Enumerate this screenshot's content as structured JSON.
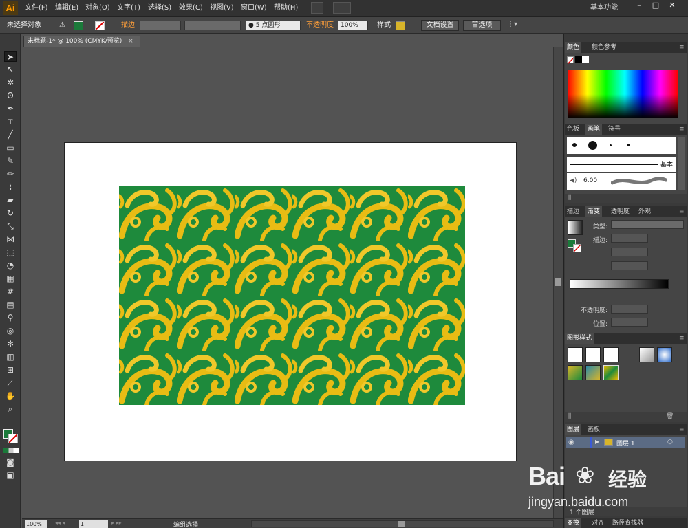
{
  "app": {
    "logo": "Ai",
    "menus": [
      "文件(F)",
      "编辑(E)",
      "对象(O)",
      "文字(T)",
      "选择(S)",
      "效果(C)",
      "视图(V)",
      "窗口(W)",
      "帮助(H)"
    ],
    "workspace": "基本功能",
    "window_controls": [
      "–",
      "□",
      "✕"
    ]
  },
  "control": {
    "selection_status": "未选择对象",
    "stroke_label": "描边",
    "brush_size": "5",
    "brush_shape": "点圆形",
    "opacity_label": "不透明度",
    "opacity_value": "100%",
    "style_label": "样式",
    "doc_settings": "文档设置",
    "preferences": "首选项"
  },
  "document": {
    "tab_title": "未标题-1* @ 100% (CMYK/预览)",
    "close": "×"
  },
  "status": {
    "zoom": "100%",
    "page": "1",
    "mode": "编组选择"
  },
  "panels": {
    "color_tabs": [
      "颜色",
      "颜色参考"
    ],
    "brush_tabs": [
      "色板",
      "画笔",
      "符号"
    ],
    "brush_basic": "基本",
    "brush_size": "6.00",
    "gradient_tabs": [
      "描边",
      "渐变",
      "透明度",
      "外观"
    ],
    "gradient_type_label": "类型:",
    "gradient_stroke_label": "描边:",
    "gradient_opacity_label": "不透明度:",
    "gradient_position_label": "位置:",
    "graphic_styles_tab": "图形样式",
    "layer_tabs": [
      "图层",
      "画板"
    ],
    "layer_name": "图层 1",
    "layer_count": "1 个图层",
    "bottom_tabs": [
      "变换",
      "对齐",
      "路径查找器"
    ]
  },
  "watermark": {
    "brand": "Bai",
    "brand2": "经验",
    "url": "jingyan.baidu.com"
  },
  "colors": {
    "fill": "#1b7a3a",
    "pattern_gold": "#e6b800",
    "pattern_green": "#1e8a3c"
  }
}
